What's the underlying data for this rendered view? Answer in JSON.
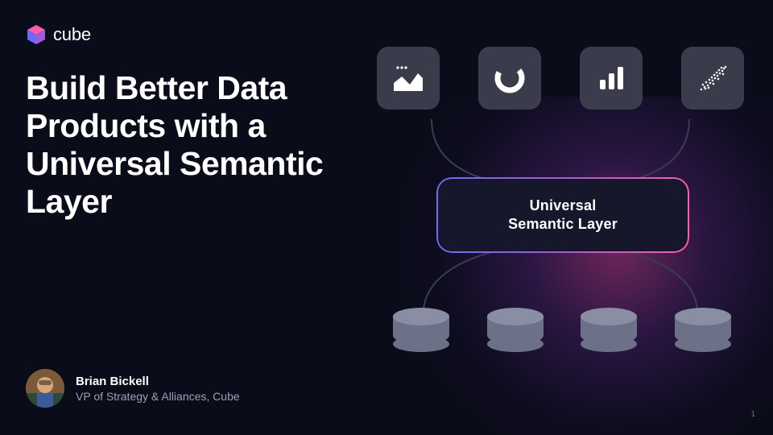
{
  "brand": {
    "name": "cube"
  },
  "title": "Build Better Data Products with a Universal Semantic Layer",
  "diagram": {
    "tiles": [
      "area-chart",
      "donut-chart",
      "bar-chart",
      "scatter-chart"
    ],
    "box_line1": "Universal",
    "box_line2": "Semantic Layer",
    "databases": 4
  },
  "speaker": {
    "name": "Brian Bickell",
    "role": "VP of Strategy & Alliances, Cube"
  },
  "page_number": "1"
}
